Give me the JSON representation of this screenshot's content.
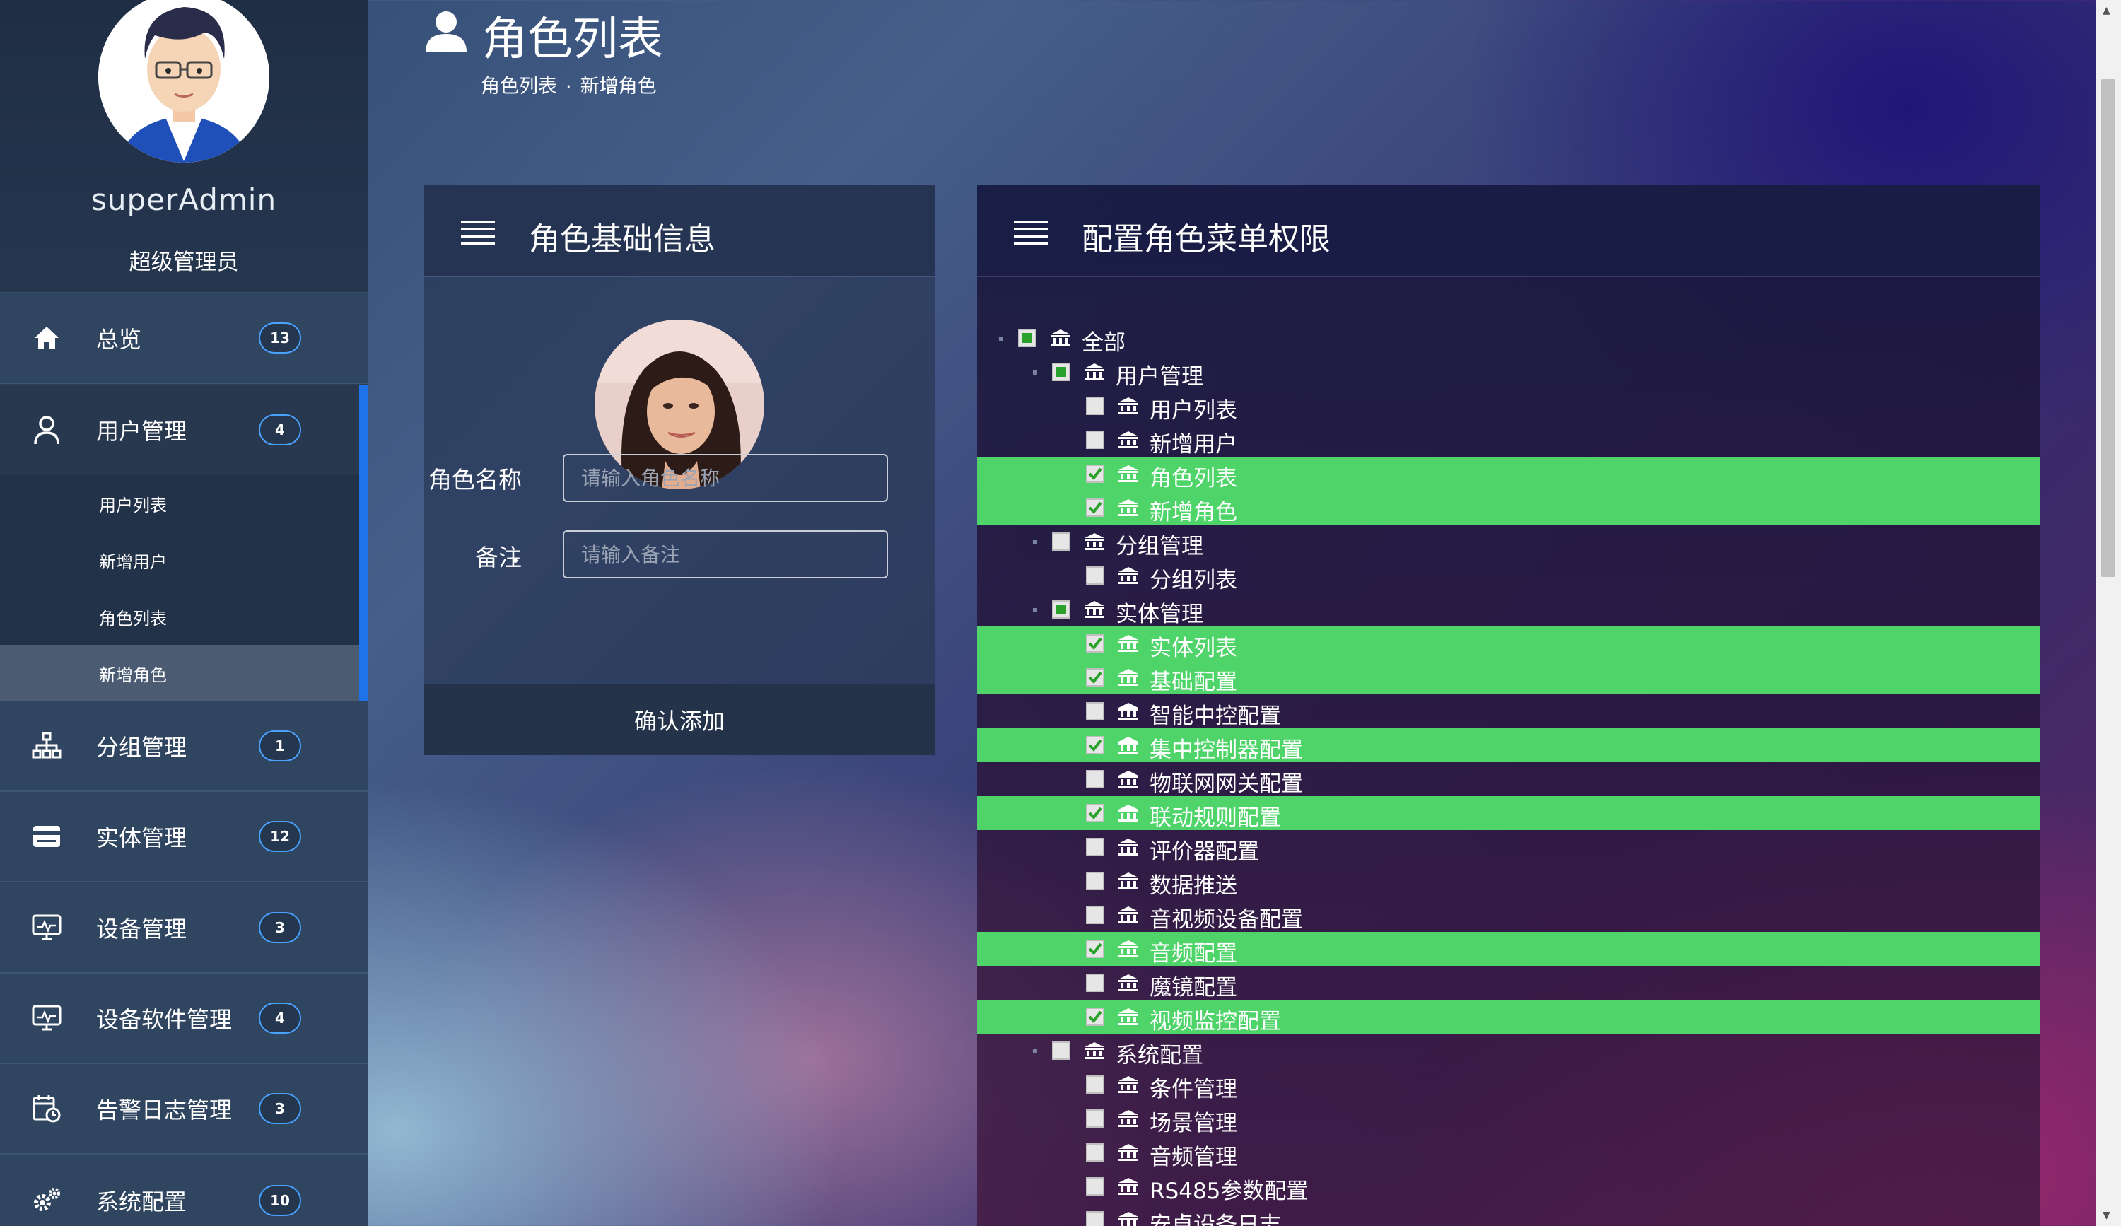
{
  "user": {
    "name": "superAdmin",
    "role": "超级管理员"
  },
  "sidebar": {
    "items": [
      {
        "label": "总览",
        "badge": "13"
      },
      {
        "label": "用户管理",
        "badge": "4"
      },
      {
        "label": "分组管理",
        "badge": "1"
      },
      {
        "label": "实体管理",
        "badge": "12"
      },
      {
        "label": "设备管理",
        "badge": "3"
      },
      {
        "label": "设备软件管理",
        "badge": "4"
      },
      {
        "label": "告警日志管理",
        "badge": "3"
      },
      {
        "label": "系统配置",
        "badge": "10"
      }
    ],
    "submenu": [
      "用户列表",
      "新增用户",
      "角色列表",
      "新增角色"
    ],
    "active_submenu": "新增角色"
  },
  "header": {
    "title": "角色列表",
    "breadcrumb": [
      "角色列表",
      ".",
      "新增角色"
    ]
  },
  "form_panel": {
    "title": "角色基础信息",
    "name_label": "角色名称",
    "name_placeholder": "请输入角色名称",
    "note_label": "备注",
    "note_placeholder": "请输入备注",
    "submit_label": "确认添加"
  },
  "permission_panel": {
    "title": "配置角色菜单权限",
    "tree": [
      {
        "label": "全部",
        "level": 0,
        "state": "partial",
        "expanded": true
      },
      {
        "label": "用户管理",
        "level": 1,
        "state": "partial",
        "expanded": true
      },
      {
        "label": "用户列表",
        "level": 2,
        "state": "unchecked"
      },
      {
        "label": "新增用户",
        "level": 2,
        "state": "unchecked"
      },
      {
        "label": "角色列表",
        "level": 2,
        "state": "checked"
      },
      {
        "label": "新增角色",
        "level": 2,
        "state": "checked"
      },
      {
        "label": "分组管理",
        "level": 1,
        "state": "unchecked",
        "expanded": true
      },
      {
        "label": "分组列表",
        "level": 2,
        "state": "unchecked"
      },
      {
        "label": "实体管理",
        "level": 1,
        "state": "partial",
        "expanded": true
      },
      {
        "label": "实体列表",
        "level": 2,
        "state": "checked"
      },
      {
        "label": "基础配置",
        "level": 2,
        "state": "checked"
      },
      {
        "label": "智能中控配置",
        "level": 2,
        "state": "unchecked"
      },
      {
        "label": "集中控制器配置",
        "level": 2,
        "state": "checked"
      },
      {
        "label": "物联网网关配置",
        "level": 2,
        "state": "unchecked"
      },
      {
        "label": "联动规则配置",
        "level": 2,
        "state": "checked"
      },
      {
        "label": "评价器配置",
        "level": 2,
        "state": "unchecked"
      },
      {
        "label": "数据推送",
        "level": 2,
        "state": "unchecked"
      },
      {
        "label": "音视频设备配置",
        "level": 2,
        "state": "unchecked"
      },
      {
        "label": "音频配置",
        "level": 2,
        "state": "checked"
      },
      {
        "label": "魔镜配置",
        "level": 2,
        "state": "unchecked"
      },
      {
        "label": "视频监控配置",
        "level": 2,
        "state": "checked"
      },
      {
        "label": "系统配置",
        "level": 1,
        "state": "unchecked",
        "expanded": true
      },
      {
        "label": "条件管理",
        "level": 2,
        "state": "unchecked"
      },
      {
        "label": "场景管理",
        "level": 2,
        "state": "unchecked"
      },
      {
        "label": "音频管理",
        "level": 2,
        "state": "unchecked"
      },
      {
        "label": "RS485参数配置",
        "level": 2,
        "state": "unchecked"
      },
      {
        "label": "安卓设备日志",
        "level": 2,
        "state": "unchecked"
      }
    ]
  },
  "colors": {
    "highlight": "#4fd469",
    "badge_border": "#4aa2ff",
    "active_bar": "#1e73e8",
    "check": "#2aa12a"
  },
  "icons": {
    "nav": [
      "home-icon",
      "user-icon",
      "org-tree-icon",
      "card-icon",
      "monitor-icon",
      "monitor-icon",
      "calendar-clock-icon",
      "gears-icon"
    ],
    "tree_node": "bank-building-icon",
    "panel_header": "list-lines-icon"
  }
}
